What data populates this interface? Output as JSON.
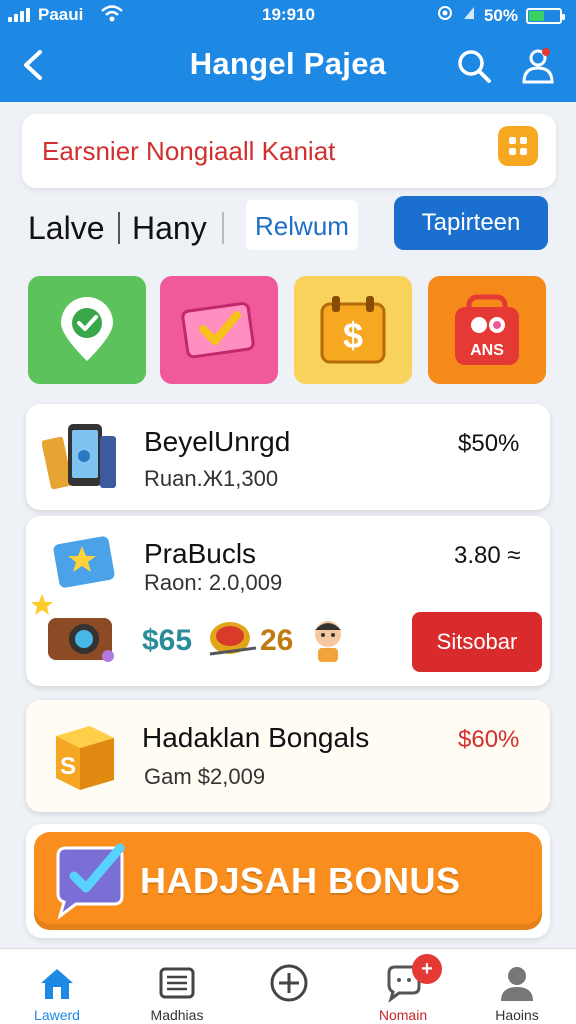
{
  "status_bar": {
    "carrier": "Paaui",
    "time": "19:910",
    "battery": "50%",
    "battery_level": 0.5
  },
  "header": {
    "title": "Hangel Pajea",
    "back_icon": "chevron-left-icon",
    "search_icon": "search-icon",
    "profile_icon": "profile-icon"
  },
  "banner": {
    "text": "Earsnier Nongiaall Kaniat",
    "icon": "grid-icon"
  },
  "tabs": {
    "items": [
      {
        "label": "Lalve"
      },
      {
        "label": "Hany"
      }
    ],
    "active_label": "Relwum",
    "primary_button": "Tapirteen"
  },
  "categories": [
    {
      "icon": "location-check-icon",
      "color": "#5cc35c"
    },
    {
      "icon": "checkmark-card-icon",
      "color": "#f05a9a"
    },
    {
      "icon": "dollar-calendar-icon",
      "color": "#f8d25a"
    },
    {
      "icon": "badge-icon",
      "color": "#f58a1a",
      "label": "ANS"
    }
  ],
  "cards": [
    {
      "title": "BeyelUnrgd",
      "subtitle": "Ruan.Ж1,300",
      "value": "$50%"
    },
    {
      "title": "PraBucls",
      "subtitle": "Raon: 2.0,009",
      "value": "3.80 ≈",
      "reward_a": "$65",
      "reward_b": "26",
      "button": "Sitsobar"
    },
    {
      "title": "Hadaklan Bongals",
      "subtitle": "Gam $2,009",
      "value": "$60%"
    }
  ],
  "bonus": {
    "label": "HADJSAH BONUS"
  },
  "bottom_nav": [
    {
      "label": "Lawerd",
      "icon": "home-icon",
      "active": true
    },
    {
      "label": "Madhias",
      "icon": "list-icon"
    },
    {
      "label": "",
      "icon": "add-icon"
    },
    {
      "label": "Nomain",
      "icon": "chat-icon",
      "badge": "+"
    },
    {
      "label": "Haoins",
      "icon": "user-icon"
    }
  ],
  "colors": {
    "primary": "#1e88e5",
    "accent_orange": "#f98d1e",
    "danger": "#d92b2b"
  }
}
